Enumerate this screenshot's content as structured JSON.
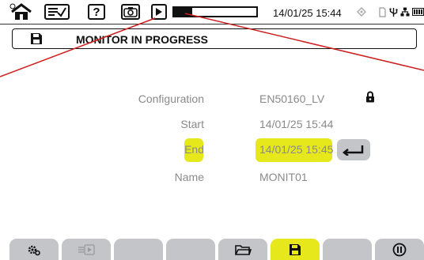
{
  "topbar": {
    "icons": [
      "home-icon",
      "checklist-icon",
      "help-icon",
      "camera-icon",
      "play-icon"
    ],
    "help_glyph": "?",
    "datetime": "14/01/25 15:44",
    "progress": 0.22
  },
  "header": {
    "title": "MONITOR IN PROGRESS"
  },
  "form": {
    "configuration_label": "Configuration",
    "configuration_value": "EN50160_LV",
    "start_label": "Start",
    "start_value": "14/01/25 15:44",
    "end_label": "End",
    "end_value": "14/01/25 15:45",
    "name_label": "Name",
    "name_value": "MONIT01"
  },
  "tabs": [
    "settings-icon",
    "export-icon",
    "",
    "",
    "folder-icon",
    "save-icon",
    "",
    "pause-icon"
  ],
  "colors": {
    "highlight": "#e6e81b",
    "tab_gray": "#c3c5c9",
    "callout_red": "#cc2020",
    "label_gray": "#8a8a8a"
  }
}
